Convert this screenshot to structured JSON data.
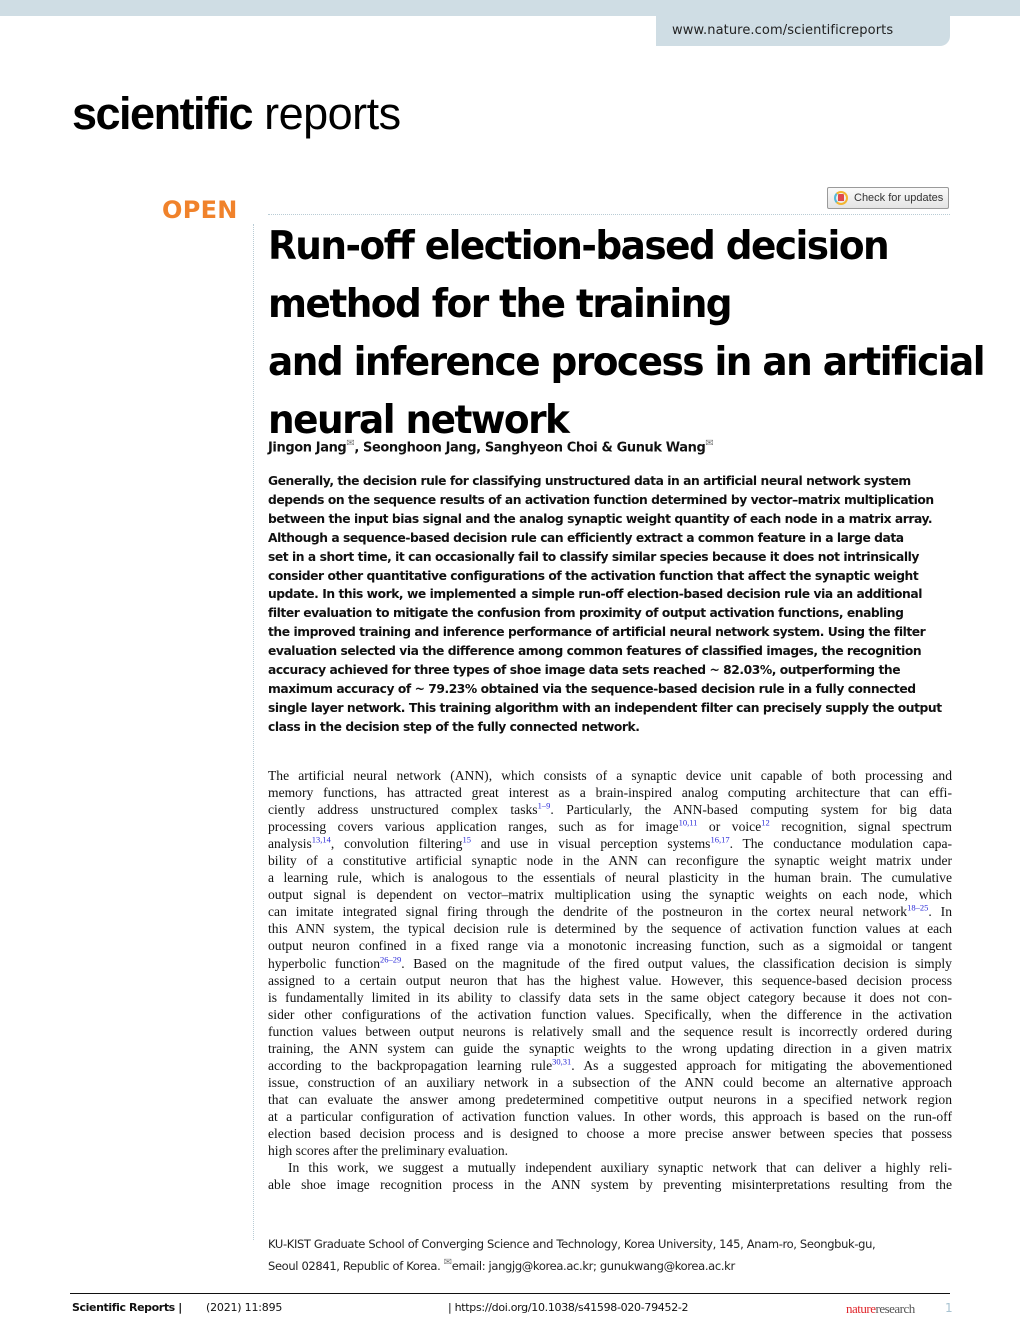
{
  "header": {
    "url": "www.nature.com/scientificreports",
    "journal_logo_bold": "scientific",
    "journal_logo_light": "reports",
    "check_updates_label": "Check for updates",
    "check_updates_icon": "crossmark-icon",
    "open_label": "OPEN"
  },
  "article": {
    "title_lines": [
      "Run-off election-based decision",
      "method for the training",
      "and inference process in an artificial",
      "neural network"
    ],
    "authors": [
      {
        "name": "Jingon Jang",
        "corresponding": true
      },
      {
        "name": "Seonghoon Jang",
        "corresponding": false
      },
      {
        "name": "Sanghyeon Choi",
        "corresponding": false
      },
      {
        "name": "Gunuk Wang",
        "corresponding": true
      }
    ],
    "author_separators": [
      ", ",
      ", ",
      " & "
    ],
    "mail_icon_glyph": "✉",
    "abstract_lines": [
      "Generally, the decision rule for classifying unstructured data in an artificial neural network system",
      "depends on the sequence results of an activation function determined by vector–matrix multiplication",
      "between the input bias signal and the analog synaptic weight quantity of each node in a matrix array.",
      "Although a sequence-based decision rule can efficiently extract a common feature in a large data",
      "set in a short time, it can occasionally fail to classify similar species because it does not intrinsically",
      "consider other quantitative configurations of the activation function that affect the synaptic weight",
      "update. In this work, we implemented a simple run-off election-based decision rule via an additional",
      "filter evaluation to mitigate the confusion from proximity of output activation functions, enabling",
      "the improved training and inference performance of artificial neural network system. Using the filter",
      "evaluation selected via the difference among common features of classified images, the recognition",
      "accuracy achieved for three types of shoe image data sets reached ~ 82.03%, outperforming the",
      "maximum accuracy of ~ 79.23% obtained via the sequence-based decision rule in a fully connected",
      "single layer network. This training algorithm with an independent filter can precisely supply the output",
      "class in the decision step of the fully connected network."
    ],
    "body_lines": [
      {
        "segments": [
          {
            "t": "The artificial neural network (ANN), which consists of a synaptic device unit capable of both processing and"
          }
        ]
      },
      {
        "segments": [
          {
            "t": "memory functions, has attracted great interest as a brain-inspired analog computing architecture that can effi-"
          }
        ]
      },
      {
        "segments": [
          {
            "t": "ciently address unstructured complex tasks"
          },
          {
            "r": "1–9"
          },
          {
            "t": ". Particularly, the ANN-based computing system for big data"
          }
        ]
      },
      {
        "segments": [
          {
            "t": "processing covers various application ranges, such as for image"
          },
          {
            "r": "10,11"
          },
          {
            "t": " or voice"
          },
          {
            "r": "12"
          },
          {
            "t": " recognition, signal spectrum"
          }
        ]
      },
      {
        "segments": [
          {
            "t": "analysis"
          },
          {
            "r": "13,14"
          },
          {
            "t": ", convolution filtering"
          },
          {
            "r": "15"
          },
          {
            "t": " and use in visual perception systems"
          },
          {
            "r": "16,17"
          },
          {
            "t": ". The conductance modulation capa-"
          }
        ]
      },
      {
        "segments": [
          {
            "t": "bility of a constitutive artificial synaptic node in the ANN can reconfigure the synaptic weight matrix under"
          }
        ]
      },
      {
        "segments": [
          {
            "t": "a learning rule, which is analogous to the essentials of neural plasticity in the human brain. The cumulative"
          }
        ]
      },
      {
        "segments": [
          {
            "t": "output signal is dependent on vector–matrix multiplication using the synaptic weights on each node, which"
          }
        ]
      },
      {
        "segments": [
          {
            "t": "can imitate integrated signal firing through the dendrite of the postneuron in the cortex neural network"
          },
          {
            "r": "18–25"
          },
          {
            "t": ". In"
          }
        ]
      },
      {
        "segments": [
          {
            "t": "this ANN system, the typical decision rule is determined by the sequence of activation function values at each"
          }
        ]
      },
      {
        "segments": [
          {
            "t": "output neuron confined in a fixed range via a monotonic increasing function, such as a sigmoidal or tangent"
          }
        ]
      },
      {
        "segments": [
          {
            "t": "hyperbolic function"
          },
          {
            "r": "26–29"
          },
          {
            "t": ". Based on the magnitude of the fired output values, the classification decision is simply"
          }
        ]
      },
      {
        "segments": [
          {
            "t": "assigned to a certain output neuron that has the highest value. However, this sequence-based decision process"
          }
        ]
      },
      {
        "segments": [
          {
            "t": "is fundamentally limited in its ability to classify data sets in the same object category because it does not con-"
          }
        ]
      },
      {
        "segments": [
          {
            "t": "sider other configurations of the activation function values. Specifically, when the difference in the activation"
          }
        ]
      },
      {
        "segments": [
          {
            "t": "function values between output neurons is relatively small and the sequence result is incorrectly ordered during"
          }
        ]
      },
      {
        "segments": [
          {
            "t": "training, the ANN system can guide the synaptic weights to the wrong updating direction in a given matrix"
          }
        ]
      },
      {
        "segments": [
          {
            "t": "according to the backpropagation learning rule"
          },
          {
            "r": "30,31"
          },
          {
            "t": ". As a suggested approach for mitigating the abovementioned"
          }
        ]
      },
      {
        "segments": [
          {
            "t": "issue, construction of an auxiliary network in a subsection of the ANN could become an alternative approach"
          }
        ]
      },
      {
        "segments": [
          {
            "t": "that can evaluate the answer among predetermined competitive output neurons in a specified network region"
          }
        ]
      },
      {
        "segments": [
          {
            "t": "at a particular configuration of activation function values. In other words, this approach is based on the run-off"
          }
        ]
      },
      {
        "segments": [
          {
            "t": "election based decision process and is designed to choose a more precise answer between species that possess"
          }
        ]
      },
      {
        "segments": [
          {
            "t": "high scores after the preliminary evaluation."
          }
        ],
        "last": true
      },
      {
        "segments": [
          {
            "t": "In this work, we suggest a mutually independent auxiliary synaptic network that can deliver a highly reli-"
          }
        ],
        "indent": true
      },
      {
        "segments": [
          {
            "t": "able shoe image recognition process in the ANN system by preventing misinterpretations resulting from the"
          }
        ]
      }
    ],
    "affiliation_line1": "KU-KIST Graduate School of Converging Science and Technology, Korea University, 145, Anam-ro, Seongbuk-gu,",
    "affiliation_line2_prefix": "Seoul 02841, Republic of Korea. ",
    "email_label": "email: ",
    "emails": "jangjg@korea.ac.kr; gunukwang@korea.ac.kr"
  },
  "footer": {
    "journal": "Scientific Reports |",
    "citation": "(2021) 11:895",
    "doi": "| https://doi.org/10.1038/s41598-020-79452-2",
    "publisher_a": "nature",
    "publisher_b": "research",
    "page_number": "1"
  },
  "colors": {
    "open_accent": "#f0822b",
    "header_bar": "#cfdde4",
    "reference_link": "#2b2bd8",
    "nature_red": "#e0262b",
    "page_number": "#a9c3d1"
  }
}
